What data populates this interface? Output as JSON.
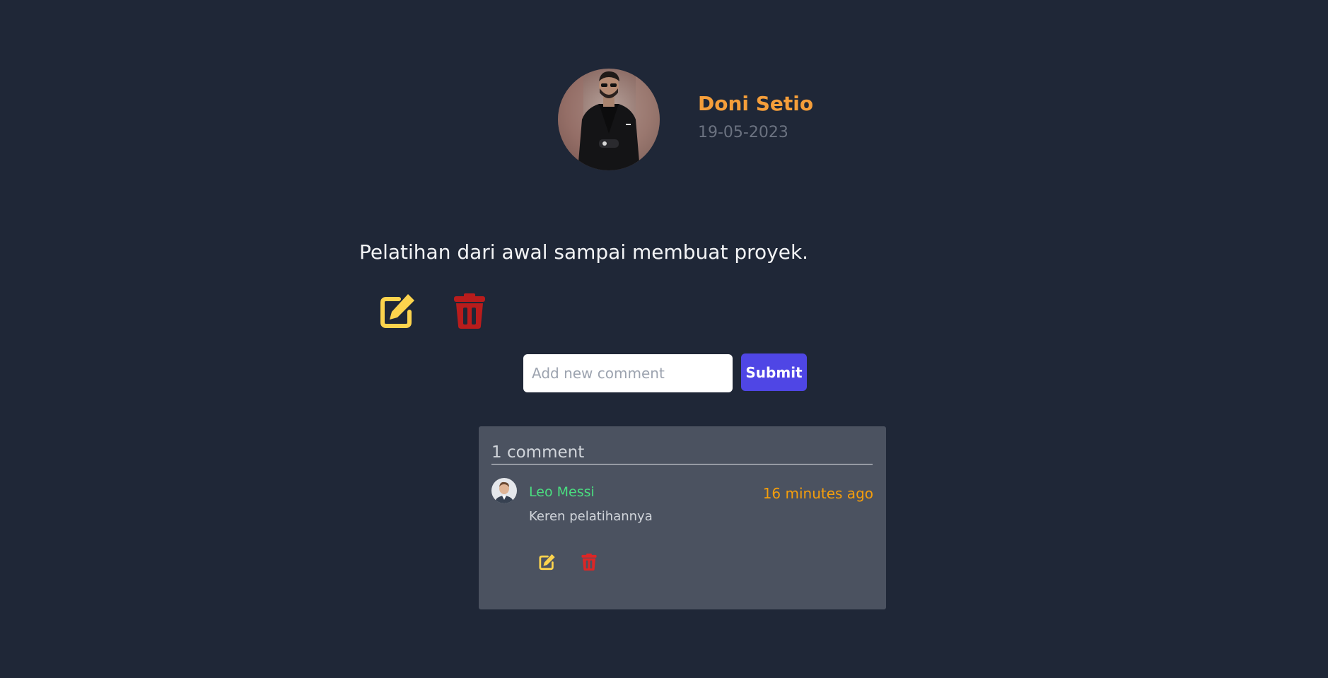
{
  "post": {
    "author_name": "Doni Setio",
    "date": "19-05-2023",
    "content": "Pelatihan dari awal sampai membuat proyek.",
    "edit_icon": "edit-icon",
    "delete_icon": "trash-icon"
  },
  "comment_form": {
    "placeholder": "Add new comment",
    "submit_label": "Submit"
  },
  "comments": {
    "count_label": "1 comment",
    "items": [
      {
        "author": "Leo Messi",
        "time": "16 minutes ago",
        "text": "Keren pelatihannya",
        "edit_icon": "edit-icon",
        "delete_icon": "trash-icon"
      }
    ]
  },
  "colors": {
    "background": "#1f2737",
    "author_name": "#f59e3a",
    "edit_icon": "#fcd34d",
    "delete_icon": "#b91c1c",
    "submit_button": "#4f46e5",
    "comment_panel": "#4b5260",
    "comment_author": "#4ade80",
    "comment_time": "#f59e0b"
  }
}
